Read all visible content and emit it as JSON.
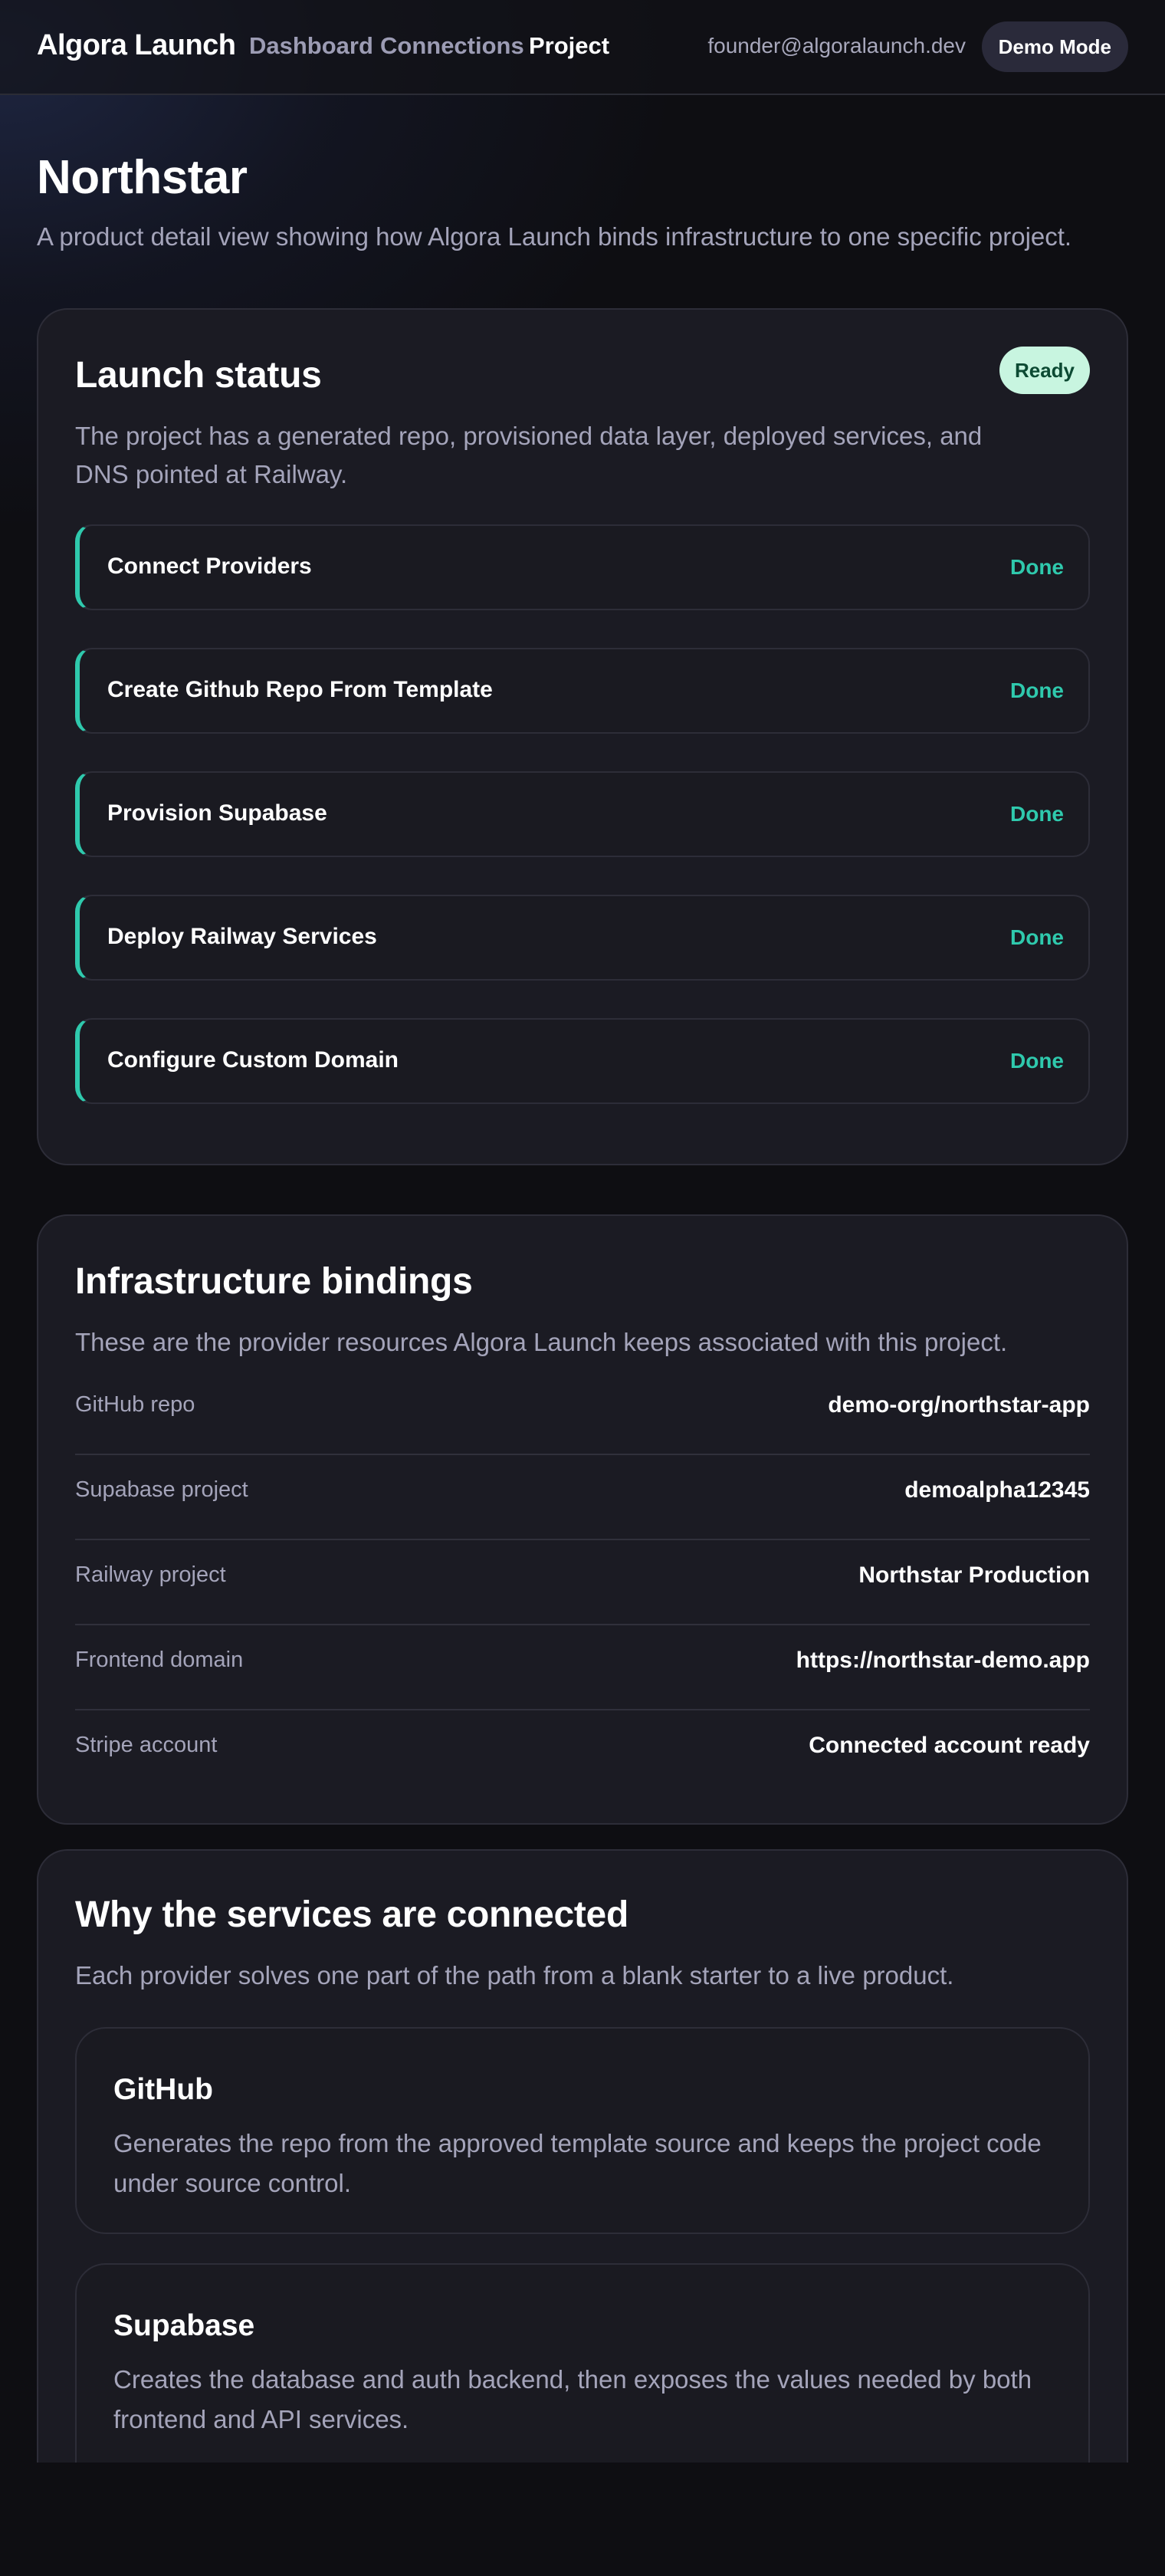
{
  "nav": {
    "brand": "Algora Launch",
    "links": [
      "Dashboard",
      "Connections",
      "Project"
    ],
    "active": "Project",
    "user_email": "founder@algoralaunch.dev",
    "demo_button": "Demo Mode"
  },
  "page": {
    "title": "Northstar",
    "subtitle": "A product detail view showing how Algora Launch binds infrastructure to one specific project."
  },
  "launch_status": {
    "title": "Launch status",
    "badge": "Ready",
    "description": "The project has a generated repo, provisioned data layer, deployed services, and DNS pointed at Railway.",
    "steps": [
      {
        "name": "Connect Providers",
        "status": "Done"
      },
      {
        "name": "Create Github Repo From Template",
        "status": "Done"
      },
      {
        "name": "Provision Supabase",
        "status": "Done"
      },
      {
        "name": "Deploy Railway Services",
        "status": "Done"
      },
      {
        "name": "Configure Custom Domain",
        "status": "Done"
      }
    ],
    "accent_color": "#2fc9ad"
  },
  "bindings": {
    "title": "Infrastructure bindings",
    "description": "These are the provider resources Algora Launch keeps associated with this project.",
    "rows": [
      {
        "label": "GitHub repo",
        "value": "demo-org/northstar-app"
      },
      {
        "label": "Supabase project",
        "value": "demoalpha12345"
      },
      {
        "label": "Railway project",
        "value": "Northstar Production"
      },
      {
        "label": "Frontend domain",
        "value": "https://northstar-demo.app"
      },
      {
        "label": "Stripe account",
        "value": "Connected account ready"
      }
    ]
  },
  "why": {
    "title": "Why the services are connected",
    "description": "Each provider solves one part of the path from a blank starter to a live product.",
    "services": [
      {
        "name": "GitHub",
        "description": "Generates the repo from the approved template source and keeps the project code under source control."
      },
      {
        "name": "Supabase",
        "description": "Creates the database and auth backend, then exposes the values needed by both frontend and API services."
      }
    ]
  },
  "colors": {
    "background": "#0e0e12",
    "card": "#1b1b23",
    "badge_bg": "#c8f5e0",
    "badge_text": "#0c4a33",
    "muted_text": "#a4a4ba"
  }
}
